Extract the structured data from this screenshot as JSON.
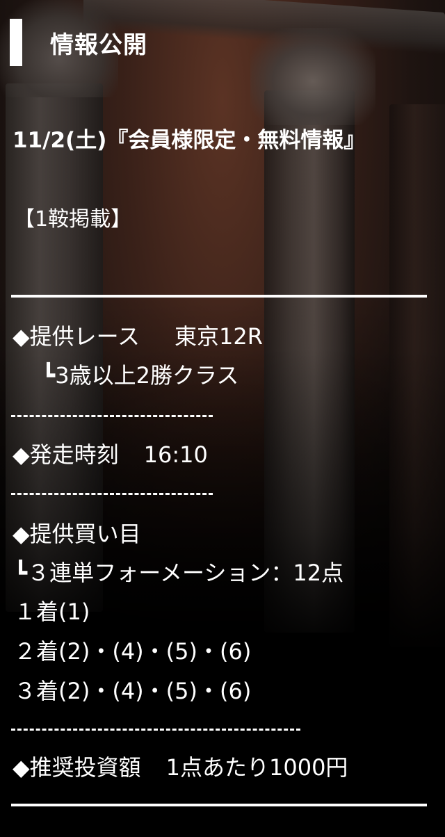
{
  "header": {
    "title": "情報公開"
  },
  "info": {
    "date_title": "11/2(土)『会員様限定・無料情報』",
    "notice": "【1鞍掲載】",
    "race_label": "◆提供レース",
    "race_value": "東京12R",
    "race_class": "┗3歳以上2勝クラス",
    "start_label": "◆発走時刻",
    "start_value": "16:10",
    "buy_label": "◆提供買い目",
    "buy_type": "┗３連単フォーメーション：12点",
    "position_1": "１着(1)",
    "position_2": "２着(2)・(4)・(5)・(6)",
    "position_3": "３着(2)・(4)・(5)・(6)",
    "amount_label": "◆推奨投資額",
    "amount_value": "1点あたり1000円"
  },
  "colors": {
    "text": "#ffffff",
    "background": "#0d0b0a",
    "accent_bar": "#ffffff"
  }
}
